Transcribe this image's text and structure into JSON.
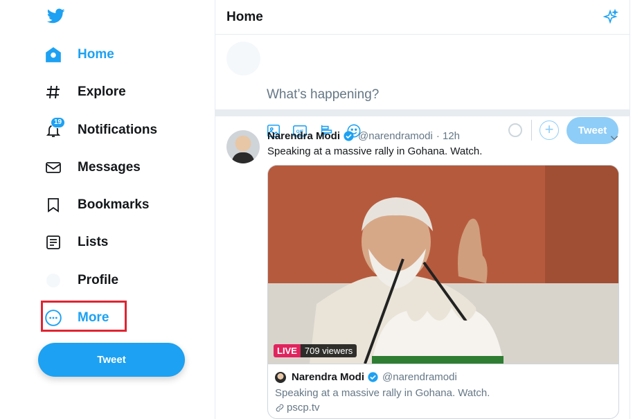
{
  "nav": {
    "items": [
      {
        "label": "Home",
        "icon": "home-icon"
      },
      {
        "label": "Explore",
        "icon": "hashtag-icon"
      },
      {
        "label": "Notifications",
        "icon": "bell-icon",
        "badge": "19"
      },
      {
        "label": "Messages",
        "icon": "envelope-icon"
      },
      {
        "label": "Bookmarks",
        "icon": "bookmark-icon"
      },
      {
        "label": "Lists",
        "icon": "list-icon"
      },
      {
        "label": "Profile",
        "icon": "profile-avatar-icon"
      },
      {
        "label": "More",
        "icon": "more-dots-icon"
      }
    ],
    "tweet_button": "Tweet"
  },
  "header": {
    "title": "Home"
  },
  "composer": {
    "placeholder": "What’s happening?",
    "tweet_button": "Tweet",
    "tools": [
      "image-icon",
      "gif-icon",
      "poll-icon",
      "emoji-icon"
    ]
  },
  "tweet": {
    "name": "Narendra Modi",
    "handle": "@narendramodi",
    "time": "· 12h",
    "text": "Speaking at a massive rally in Gohana. Watch.",
    "live_label": "LIVE",
    "viewers": "709 viewers",
    "card": {
      "name": "Narendra Modi",
      "handle": "@narendramodi",
      "text": "Speaking at a massive rally in Gohana. Watch.",
      "link": "pscp.tv"
    }
  },
  "colors": {
    "accent": "#1da1f2",
    "highlight_box": "#e02431",
    "live": "#e0245e"
  }
}
